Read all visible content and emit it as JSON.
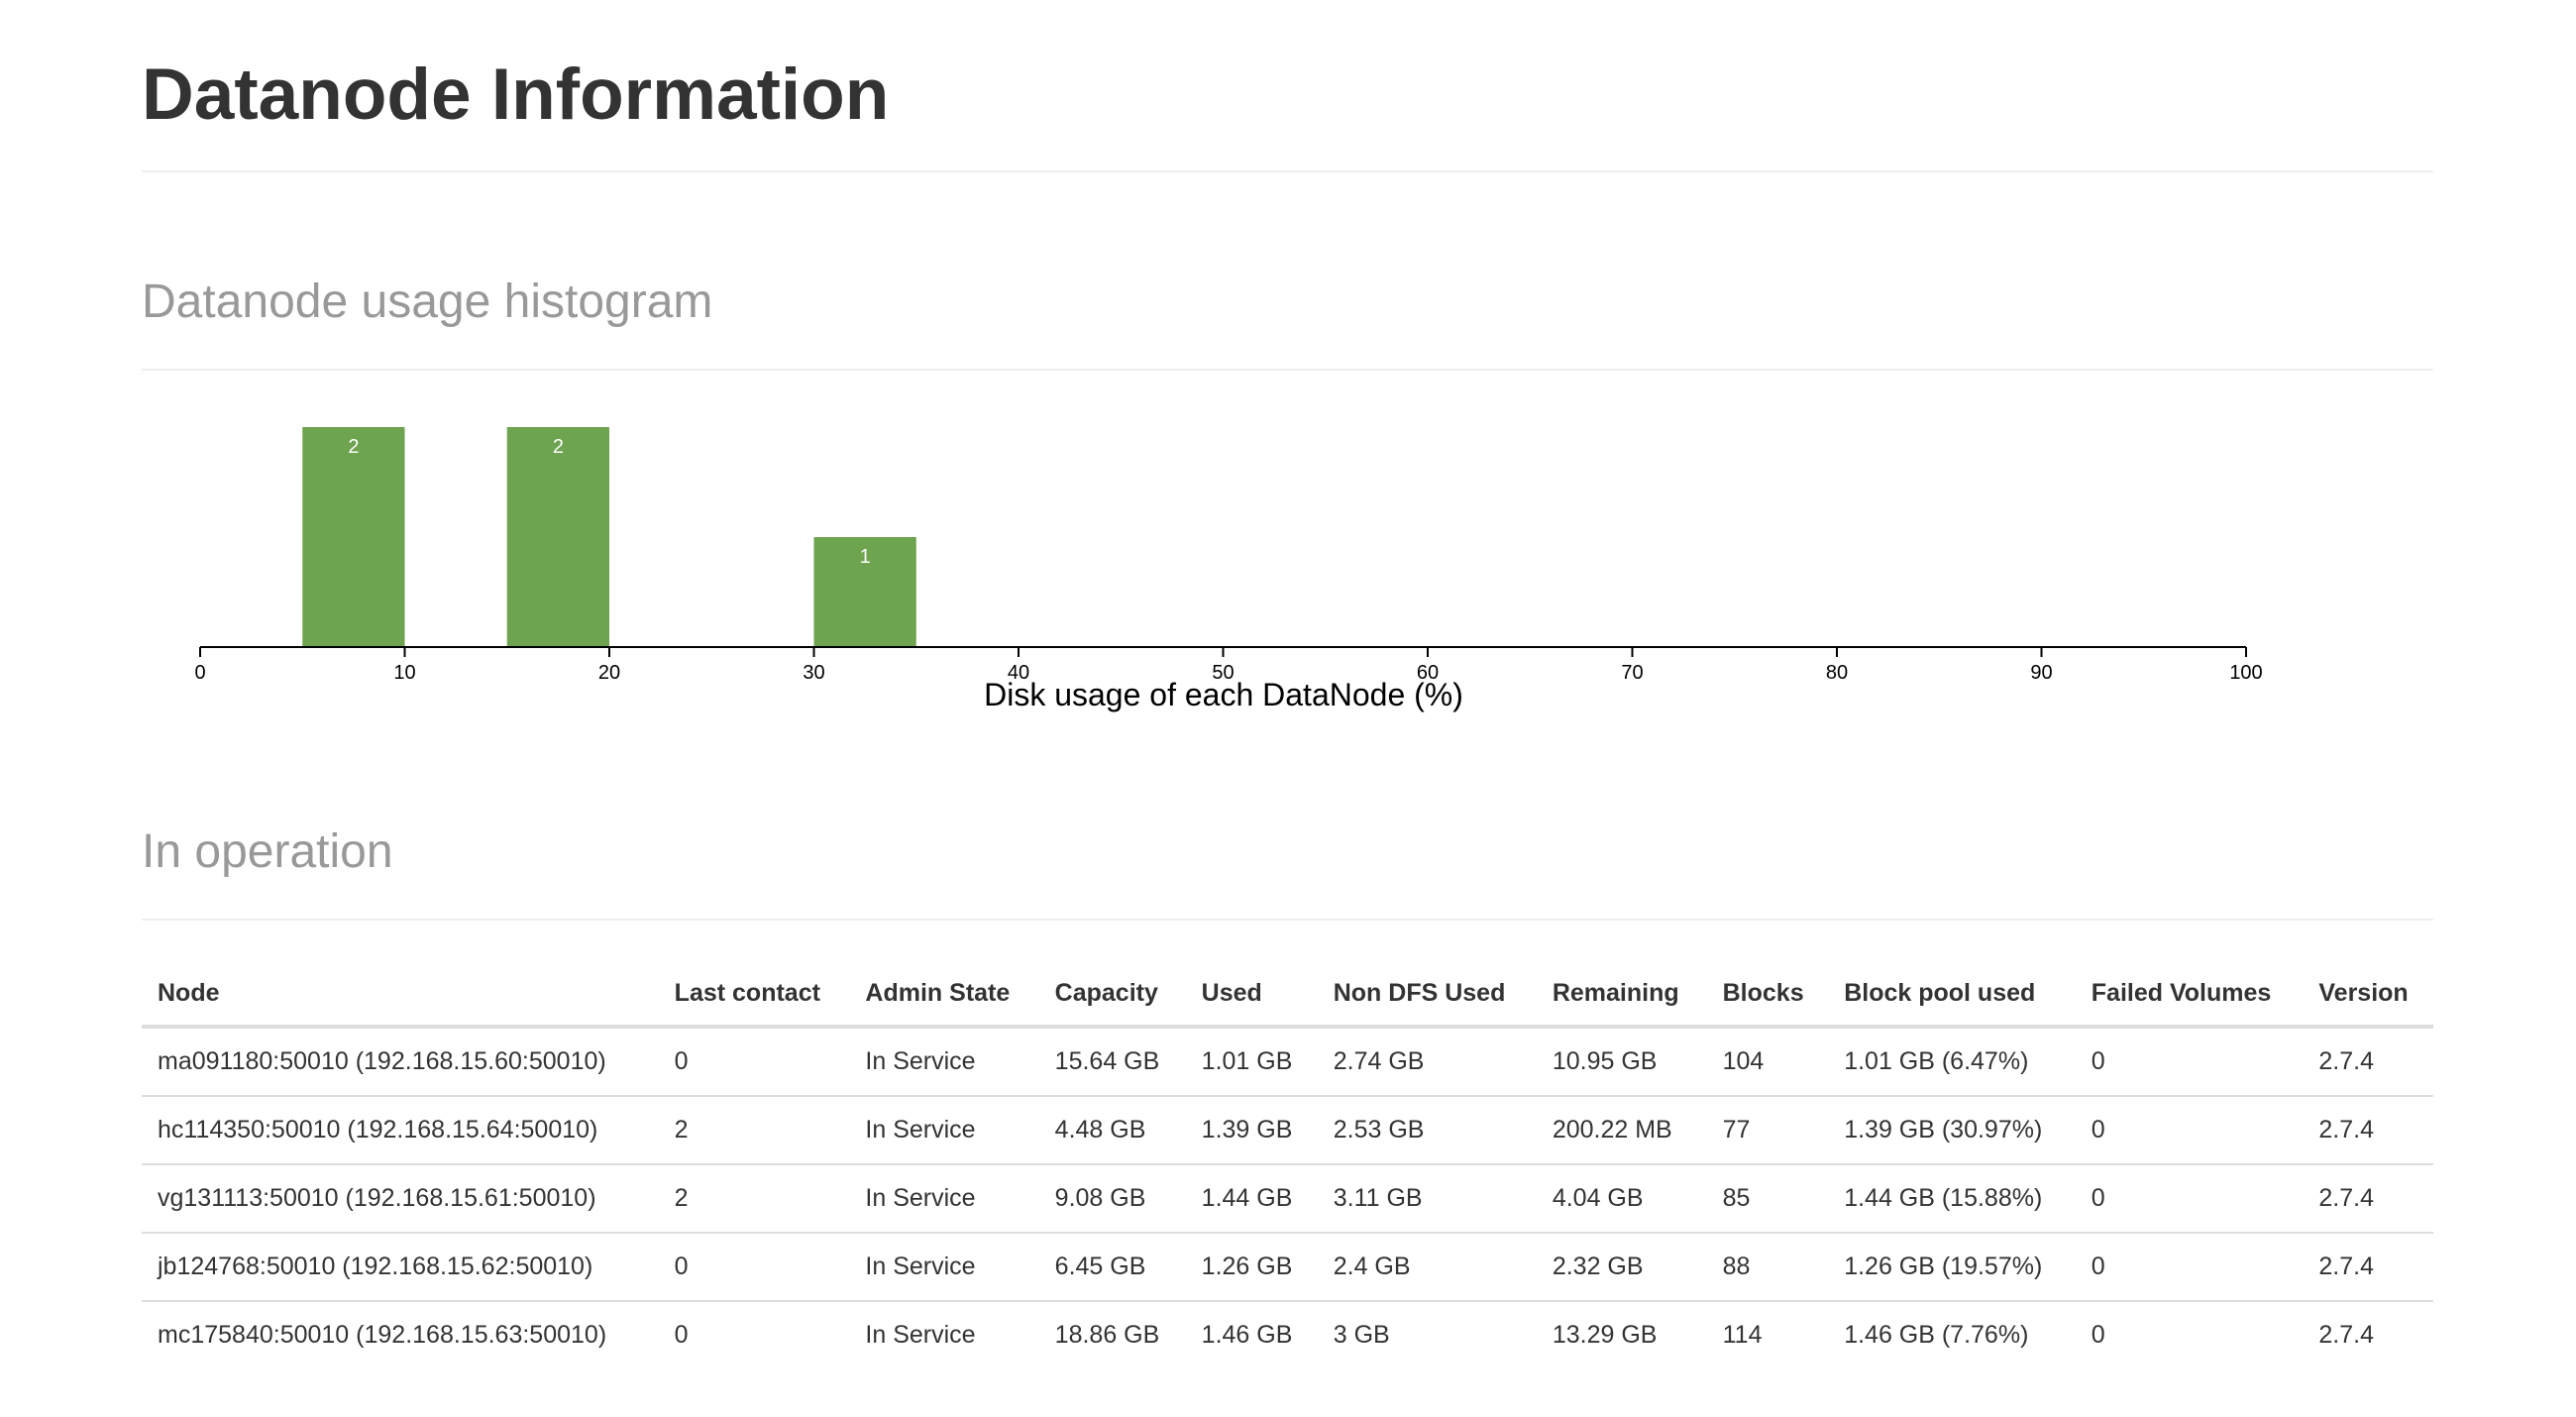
{
  "page": {
    "title": "Datanode Information"
  },
  "histogram": {
    "section_title": "Datanode usage histogram"
  },
  "chart_data": {
    "type": "bar",
    "xlabel": "Disk usage of each DataNode (%)",
    "xlim": [
      0,
      100
    ],
    "x_ticks": [
      0,
      10,
      20,
      30,
      40,
      50,
      60,
      70,
      80,
      90,
      100
    ],
    "bins": [
      {
        "start": 5,
        "end": 10,
        "count": 2
      },
      {
        "start": 15,
        "end": 20,
        "count": 2
      },
      {
        "start": 30,
        "end": 35,
        "count": 1
      }
    ],
    "bar_color": "#6ea34f",
    "label_color": "#ffffff"
  },
  "operation": {
    "section_title": "In operation",
    "columns": [
      "Node",
      "Last contact",
      "Admin State",
      "Capacity",
      "Used",
      "Non DFS Used",
      "Remaining",
      "Blocks",
      "Block pool used",
      "Failed Volumes",
      "Version"
    ],
    "rows": [
      [
        "ma091180:50010 (192.168.15.60:50010)",
        "0",
        "In Service",
        "15.64 GB",
        "1.01 GB",
        "2.74 GB",
        "10.95 GB",
        "104",
        "1.01 GB (6.47%)",
        "0",
        "2.7.4"
      ],
      [
        "hc114350:50010 (192.168.15.64:50010)",
        "2",
        "In Service",
        "4.48 GB",
        "1.39 GB",
        "2.53 GB",
        "200.22 MB",
        "77",
        "1.39 GB (30.97%)",
        "0",
        "2.7.4"
      ],
      [
        "vg131113:50010 (192.168.15.61:50010)",
        "2",
        "In Service",
        "9.08 GB",
        "1.44 GB",
        "3.11 GB",
        "4.04 GB",
        "85",
        "1.44 GB (15.88%)",
        "0",
        "2.7.4"
      ],
      [
        "jb124768:50010 (192.168.15.62:50010)",
        "0",
        "In Service",
        "6.45 GB",
        "1.26 GB",
        "2.4 GB",
        "2.32 GB",
        "88",
        "1.26 GB (19.57%)",
        "0",
        "2.7.4"
      ],
      [
        "mc175840:50010 (192.168.15.63:50010)",
        "0",
        "In Service",
        "18.86 GB",
        "1.46 GB",
        "3 GB",
        "13.29 GB",
        "114",
        "1.46 GB (7.76%)",
        "0",
        "2.7.4"
      ]
    ]
  }
}
